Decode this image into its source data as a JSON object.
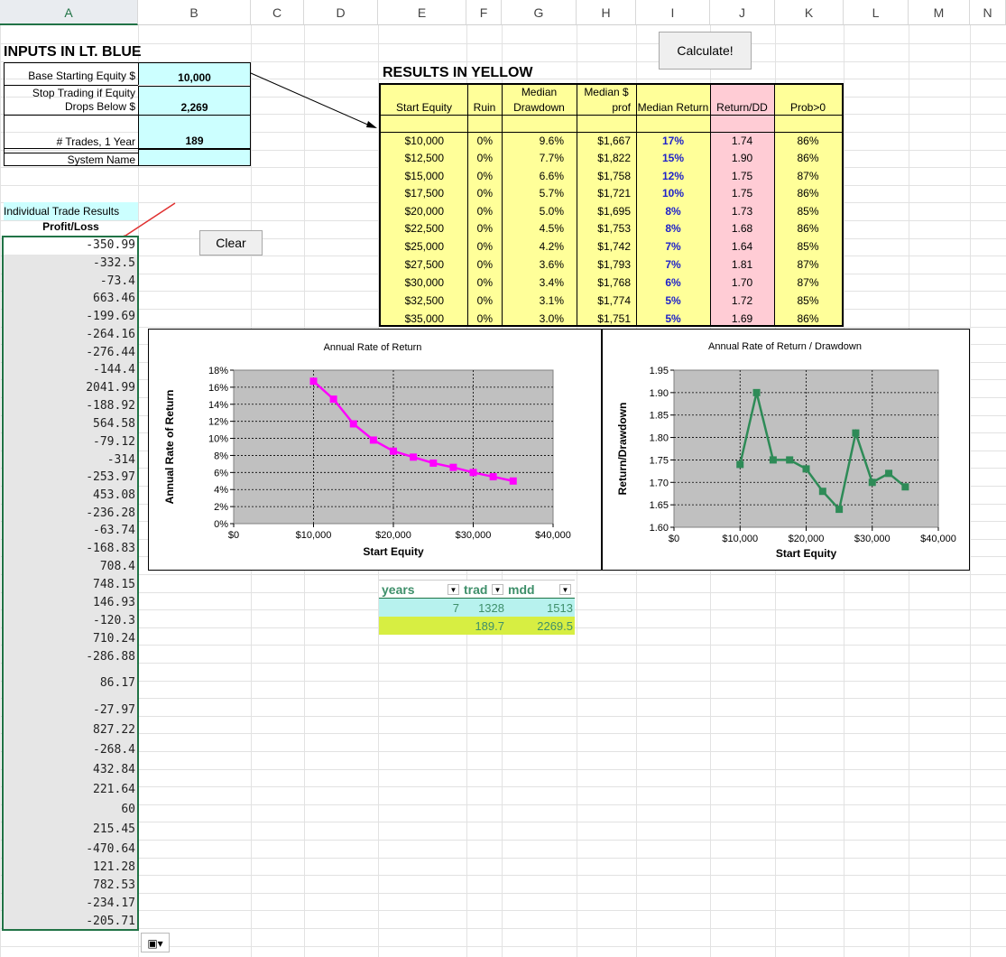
{
  "columns": [
    "A",
    "B",
    "C",
    "D",
    "E",
    "F",
    "G",
    "H",
    "I",
    "J",
    "K",
    "L",
    "M",
    "N"
  ],
  "inputs": {
    "header": "INPUTS IN LT. BLUE",
    "base_label": "Base Starting Equity $",
    "base_value": "10,000",
    "stop_label_1": "Stop Trading if Equity",
    "stop_label_2": "Drops Below $",
    "stop_value": "2,269",
    "trades_label": "# Trades, 1 Year",
    "trades_value": "189",
    "system_label": "System Name"
  },
  "buttons": {
    "calculate": "Calculate!",
    "clear": "Clear"
  },
  "trades_section": {
    "title": "Individual Trade Results",
    "header": "Profit/Loss",
    "values": [
      "-350.99",
      "-332.5",
      "-73.4",
      "663.46",
      "-199.69",
      "-264.16",
      "-276.44",
      "-144.4",
      "2041.99",
      "-188.92",
      "564.58",
      "-79.12",
      "-314",
      "-253.97",
      "453.08",
      "-236.28",
      "-63.74",
      "-168.83",
      "708.4",
      "748.15",
      "146.93",
      "-120.3",
      "710.24",
      "-286.88",
      "86.17",
      "-27.97",
      "827.22",
      "-268.4",
      "432.84",
      "221.64",
      "60",
      "215.45",
      "-470.64",
      "121.28",
      "782.53",
      "-234.17",
      "-205.71"
    ]
  },
  "results": {
    "header": "RESULTS IN YELLOW",
    "col_start": "Start Equity",
    "col_ruin": "Ruin",
    "col_mdd_1": "Median",
    "col_mdd_2": "Drawdown",
    "col_prof_1": "Median $",
    "col_prof_2": "prof",
    "col_ret": "Median Return",
    "col_rdd": "Return/DD",
    "col_prob": "Prob>0",
    "rows": [
      [
        "$10,000",
        "0%",
        "9.6%",
        "$1,667",
        "17%",
        "1.74",
        "86%"
      ],
      [
        "$12,500",
        "0%",
        "7.7%",
        "$1,822",
        "15%",
        "1.90",
        "86%"
      ],
      [
        "$15,000",
        "0%",
        "6.6%",
        "$1,758",
        "12%",
        "1.75",
        "87%"
      ],
      [
        "$17,500",
        "0%",
        "5.7%",
        "$1,721",
        "10%",
        "1.75",
        "86%"
      ],
      [
        "$20,000",
        "0%",
        "5.0%",
        "$1,695",
        "8%",
        "1.73",
        "85%"
      ],
      [
        "$22,500",
        "0%",
        "4.5%",
        "$1,753",
        "8%",
        "1.68",
        "86%"
      ],
      [
        "$25,000",
        "0%",
        "4.2%",
        "$1,742",
        "7%",
        "1.64",
        "85%"
      ],
      [
        "$27,500",
        "0%",
        "3.6%",
        "$1,793",
        "7%",
        "1.81",
        "87%"
      ],
      [
        "$30,000",
        "0%",
        "3.4%",
        "$1,768",
        "6%",
        "1.70",
        "87%"
      ],
      [
        "$32,500",
        "0%",
        "3.1%",
        "$1,774",
        "5%",
        "1.72",
        "85%"
      ],
      [
        "$35,000",
        "0%",
        "3.0%",
        "$1,751",
        "5%",
        "1.69",
        "86%"
      ]
    ]
  },
  "small_table": {
    "headers": [
      "years",
      "trad",
      "mdd"
    ],
    "row1": [
      "7",
      "1328",
      "1513"
    ],
    "row2": [
      "",
      "189.7",
      "2269.5"
    ]
  },
  "colors": {
    "accent": "#217346",
    "input": "#ccffff",
    "result": "#ffff99",
    "pink": "#ffccd5",
    "plot_bg": "#c0c0c0",
    "series1": "#ff00ff",
    "series2": "#2e8b57"
  },
  "chart_data": [
    {
      "type": "line",
      "title": "Annual Rate of Return",
      "xlabel": "Start Equity",
      "ylabel": "Annual Rate of Return",
      "x": [
        10000,
        12500,
        15000,
        17500,
        20000,
        22500,
        25000,
        27500,
        30000,
        32500,
        35000
      ],
      "y": [
        16.7,
        14.6,
        11.7,
        9.8,
        8.5,
        7.8,
        7.1,
        6.6,
        6.0,
        5.5,
        5.0
      ],
      "xlim": [
        0,
        40000
      ],
      "ylim": [
        0,
        18
      ],
      "xticks": [
        "$0",
        "$10,000",
        "$20,000",
        "$30,000",
        "$40,000"
      ],
      "yticks": [
        "0%",
        "2%",
        "4%",
        "6%",
        "8%",
        "10%",
        "12%",
        "14%",
        "16%",
        "18%"
      ],
      "grid": true
    },
    {
      "type": "line",
      "title": "Annual Rate of Return / Drawdown",
      "xlabel": "Start Equity",
      "ylabel": "Return/Drawdown",
      "x": [
        10000,
        12500,
        15000,
        17500,
        20000,
        22500,
        25000,
        27500,
        30000,
        32500,
        35000
      ],
      "y": [
        1.74,
        1.9,
        1.75,
        1.75,
        1.73,
        1.68,
        1.64,
        1.81,
        1.7,
        1.72,
        1.69
      ],
      "xlim": [
        0,
        40000
      ],
      "ylim": [
        1.6,
        1.95
      ],
      "xticks": [
        "$0",
        "$10,000",
        "$20,000",
        "$30,000",
        "$40,000"
      ],
      "yticks": [
        "1.60",
        "1.65",
        "1.70",
        "1.75",
        "1.80",
        "1.85",
        "1.90",
        "1.95"
      ],
      "grid": true
    }
  ]
}
